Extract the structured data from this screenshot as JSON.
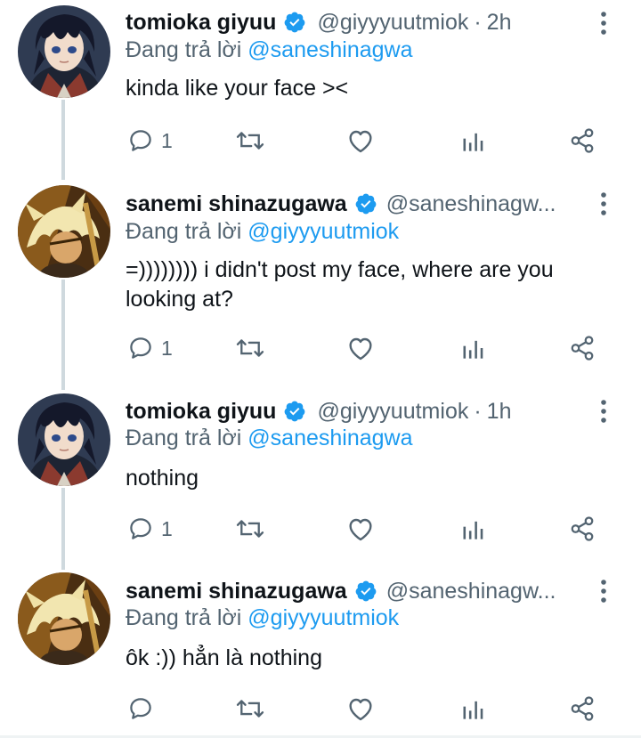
{
  "reply_prefix": "Đang trả lời",
  "colors": {
    "link": "#1d9bf0",
    "muted": "#536471",
    "verified": "#1d9bf0"
  },
  "tweets": [
    {
      "name": "tomioka giyuu",
      "handle": "@giyyyuutmiok",
      "time": "2h",
      "separator": "·",
      "reply_to": "@saneshinagwa",
      "text": "kinda like your face ><",
      "reply_count": "1",
      "avatar": "giyuu-avatar"
    },
    {
      "name": "sanemi shinazugawa",
      "handle": "@saneshinagw...",
      "time": "",
      "separator": "",
      "reply_to": "@giyyyuutmiok",
      "text": "=)))))))) i didn't post my face, where are you looking at?",
      "reply_count": "1",
      "avatar": "sanemi-avatar"
    },
    {
      "name": "tomioka giyuu",
      "handle": "@giyyyuutmiok",
      "time": "1h",
      "separator": "·",
      "reply_to": "@saneshinagwa",
      "text": "nothing",
      "reply_count": "1",
      "avatar": "giyuu-avatar"
    },
    {
      "name": "sanemi shinazugawa",
      "handle": "@saneshinagw...",
      "time": "",
      "separator": "",
      "reply_to": "@giyyyuutmiok",
      "text": "ôk :)) hẳn là nothing",
      "reply_count": "",
      "avatar": "sanemi-avatar"
    }
  ],
  "icons": [
    "reply-icon",
    "retweet-icon",
    "like-icon",
    "analytics-icon",
    "share-icon",
    "more-options-icon",
    "verified-badge-icon"
  ]
}
